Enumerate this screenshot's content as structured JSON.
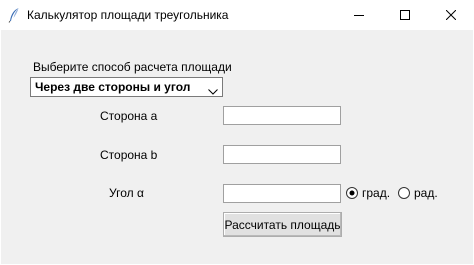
{
  "window": {
    "title": "Калькулятор площади треугольника",
    "controls": [
      "minimize",
      "maximize",
      "close"
    ]
  },
  "form": {
    "method_label": "Выберите способ расчета площади",
    "method_selected": "Через две стороны и угол",
    "side_a_label": "Сторона a",
    "side_a_value": "",
    "side_b_label": "Сторона b",
    "side_b_value": "",
    "angle_label": "Угол α",
    "angle_value": "",
    "unit_options": [
      {
        "label": "град.",
        "selected": true
      },
      {
        "label": "рад.",
        "selected": false
      }
    ],
    "calculate_label": "Рассчитать площадь"
  },
  "icons": {
    "app": "feather-icon",
    "combo_arrow": "chevron-down-icon"
  }
}
